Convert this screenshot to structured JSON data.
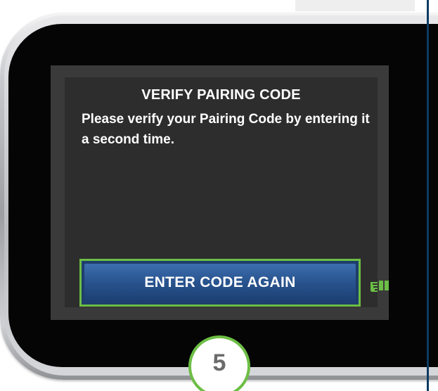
{
  "dialog": {
    "title": "VERIFY PAIRING CODE",
    "message": "Please verify your Pairing Code by entering it a second time.",
    "primary_button_label": "ENTER CODE AGAIN"
  },
  "step": {
    "number": "5"
  },
  "icons": {
    "tap_indicator": "tap-hand-icon"
  },
  "colors": {
    "accent_green": "#6cbe45",
    "button_blue": "#2a5590",
    "screen_bg": "#2d2d2d",
    "divider_blue": "#0b3b63"
  }
}
